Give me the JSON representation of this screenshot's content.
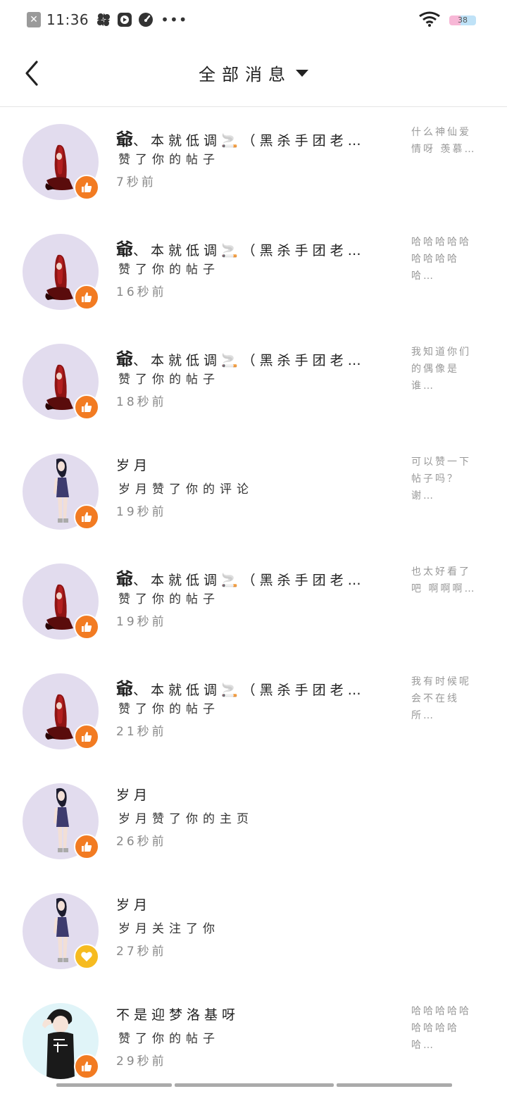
{
  "status_bar": {
    "time": "11:36",
    "battery": "38",
    "icons": [
      "close-icon",
      "pinwheel-icon",
      "play-icon",
      "gauge-icon",
      "more-dots-icon",
      "wifi-icon",
      "battery-icon"
    ]
  },
  "header": {
    "back_icon": "chevron-left-icon",
    "title": "全部消息",
    "dropdown_icon": "caret-down-icon"
  },
  "notifications": [
    {
      "name_prefix": "爺",
      "name_rest": "、本就低调🚬（黑杀手团老…",
      "action": "赞了你的帖子",
      "time": "7秒前",
      "preview": "什么神仙爱情呀 羡慕…",
      "avatar": "red-hair-figure",
      "badge": "thumbs-up-icon"
    },
    {
      "name_prefix": "爺",
      "name_rest": "、本就低调🚬（黑杀手团老…",
      "action": "赞了你的帖子",
      "time": "16秒前",
      "preview": "哈哈哈哈哈哈哈哈哈哈…",
      "avatar": "red-hair-figure",
      "badge": "thumbs-up-icon"
    },
    {
      "name_prefix": "爺",
      "name_rest": "、本就低调🚬（黑杀手团老…",
      "action": "赞了你的帖子",
      "time": "18秒前",
      "preview": "我知道你们的偶像是谁…",
      "avatar": "red-hair-figure",
      "badge": "thumbs-up-icon"
    },
    {
      "name_prefix": "",
      "name_rest": "岁月",
      "action": "岁月赞了你的评论",
      "time": "19秒前",
      "preview": "可以赞一下帖子吗？谢…",
      "avatar": "anime-girl",
      "badge": "thumbs-up-icon"
    },
    {
      "name_prefix": "爺",
      "name_rest": "、本就低调🚬（黑杀手团老…",
      "action": "赞了你的帖子",
      "time": "19秒前",
      "preview": "也太好看了吧 啊啊啊…",
      "avatar": "red-hair-figure",
      "badge": "thumbs-up-icon"
    },
    {
      "name_prefix": "爺",
      "name_rest": "、本就低调🚬（黑杀手团老…",
      "action": "赞了你的帖子",
      "time": "21秒前",
      "preview": "我有时候呢会不在线所…",
      "avatar": "red-hair-figure",
      "badge": "thumbs-up-icon"
    },
    {
      "name_prefix": "",
      "name_rest": "岁月",
      "action": "岁月赞了你的主页",
      "time": "26秒前",
      "preview": "",
      "avatar": "anime-girl",
      "badge": "thumbs-up-icon"
    },
    {
      "name_prefix": "",
      "name_rest": "岁月",
      "action": "岁月关注了你",
      "time": "27秒前",
      "preview": "",
      "avatar": "anime-girl",
      "badge": "heart-icon"
    },
    {
      "name_prefix": "",
      "name_rest": "不是迎梦洛基呀",
      "action": "赞了你的帖子",
      "time": "29秒前",
      "preview": "哈哈哈哈哈哈哈哈哈哈…",
      "avatar": "anime-boy",
      "badge": "thumbs-up-icon"
    }
  ]
}
